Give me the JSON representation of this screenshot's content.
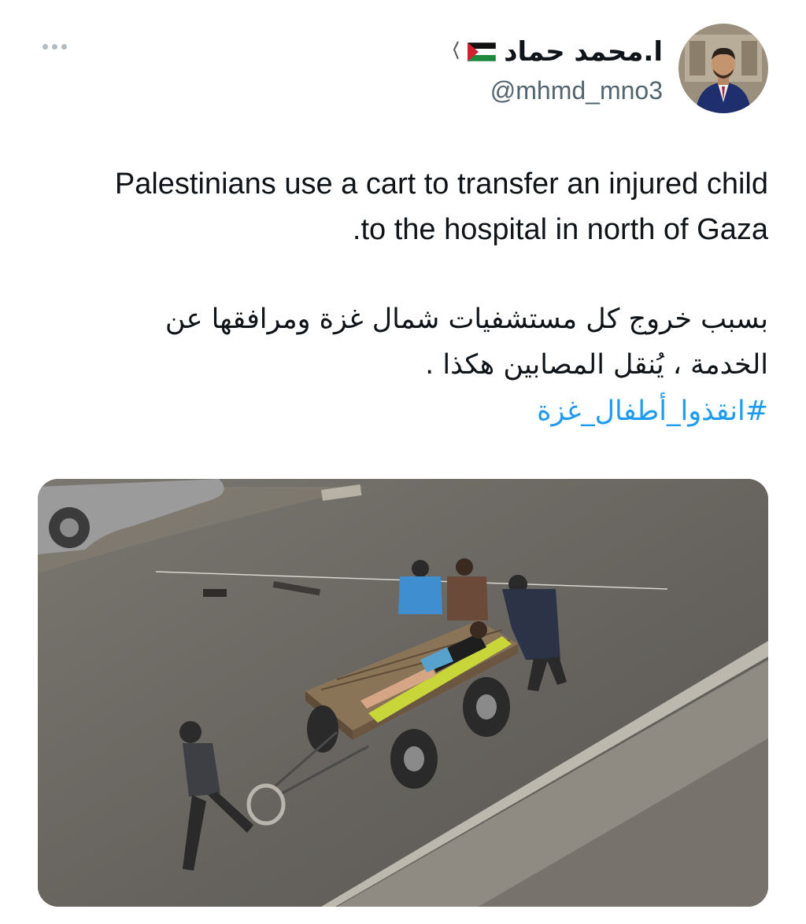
{
  "tweet": {
    "author": {
      "display_name": "ا.محمد حماد",
      "handle": "@mhmd_mno3"
    },
    "text_en": "Palestinians use a cart to transfer an injured child to the hospital in north of Gaza.",
    "text_ar": "بسبب خروج كل مستشفيات شمال غزة ومرافقها عن الخدمة ، يُنقل المصابين هكذا .",
    "hashtag": "#انقذوا_أطفال_غزة"
  },
  "icons": {
    "more": "more-horizontal-icon",
    "flag": "palestine-flag-icon"
  },
  "colors": {
    "text": "#0f1419",
    "secondary": "#536471",
    "link": "#1d9bf0"
  }
}
